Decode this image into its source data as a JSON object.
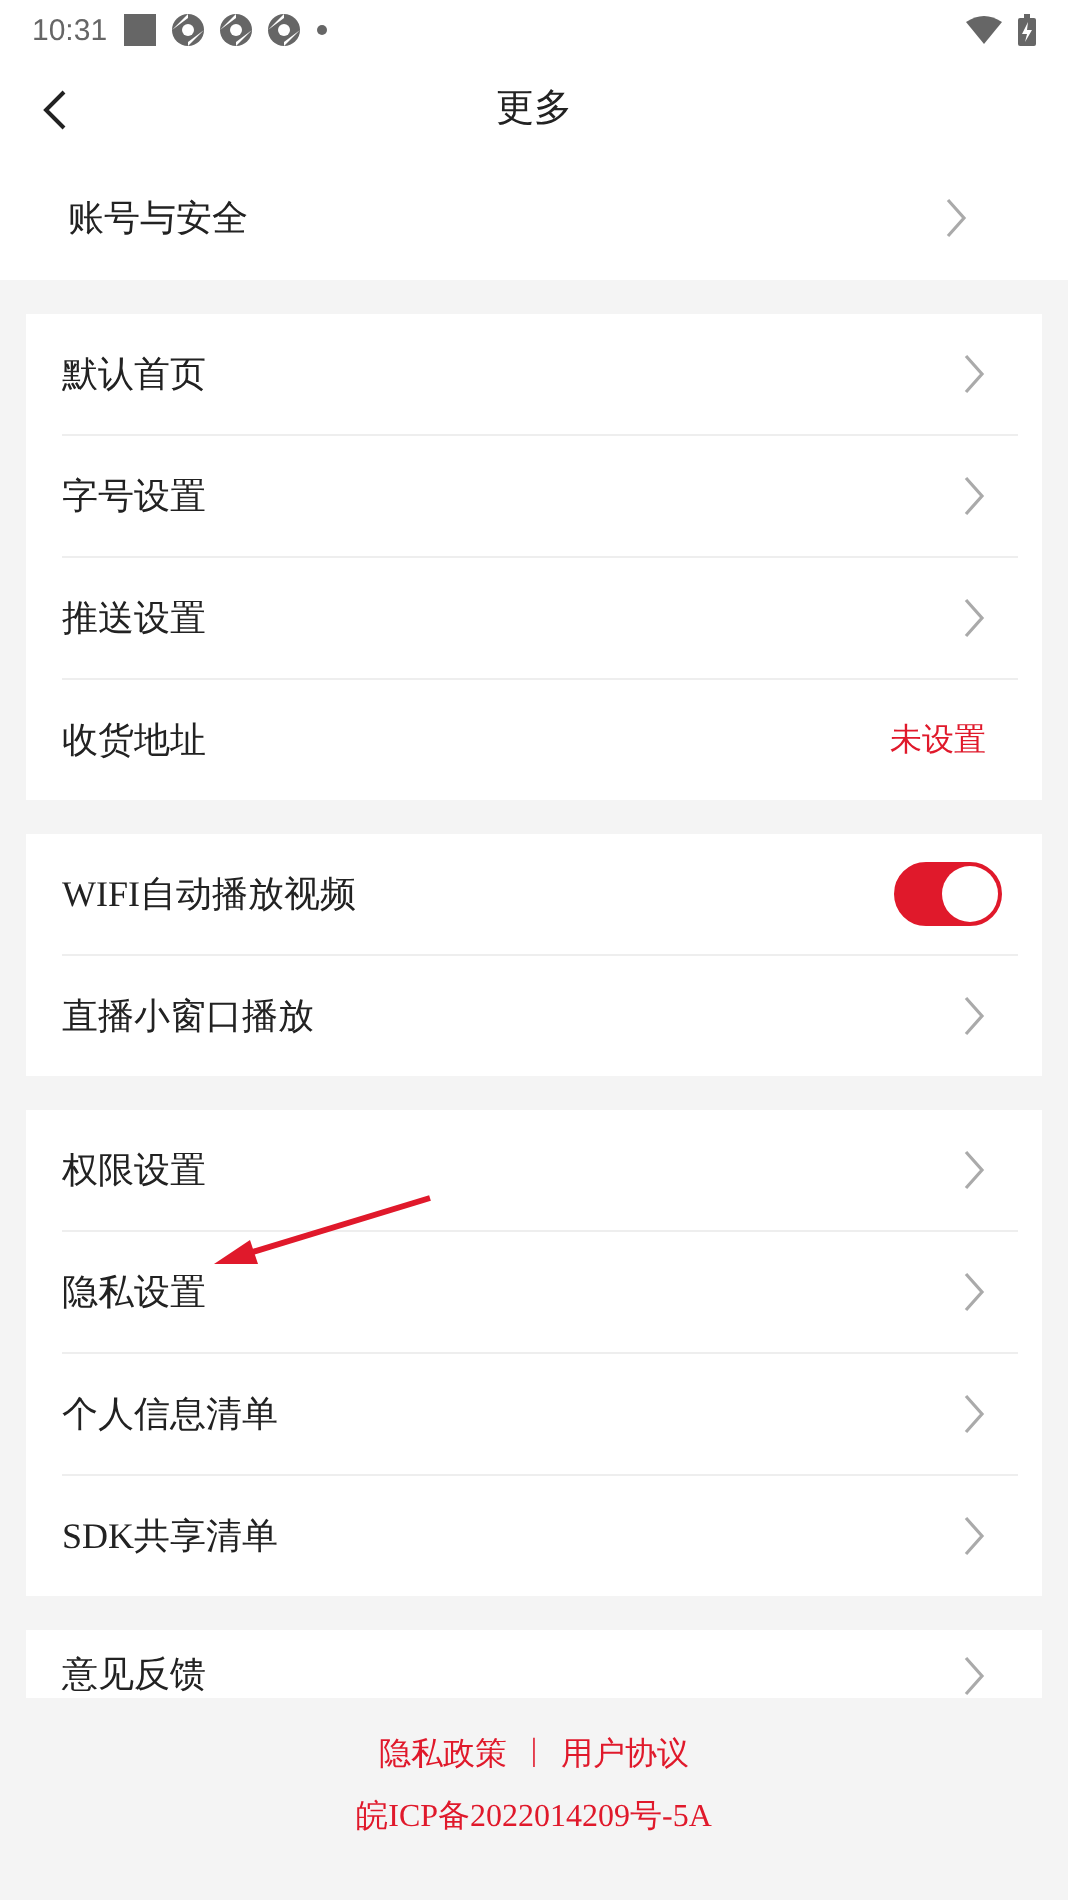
{
  "status_bar": {
    "time": "10:31"
  },
  "header": {
    "title": "更多"
  },
  "account": {
    "label": "账号与安全",
    "kind": "link"
  },
  "groups": [
    {
      "items": [
        {
          "label": "默认首页",
          "kind": "link"
        },
        {
          "label": "字号设置",
          "kind": "link"
        },
        {
          "label": "推送设置",
          "kind": "link"
        },
        {
          "label": "收货地址",
          "kind": "value",
          "value": "未设置"
        }
      ]
    },
    {
      "items": [
        {
          "label": "WIFI自动播放视频",
          "kind": "toggle",
          "on": true
        },
        {
          "label": "直播小窗口播放",
          "kind": "link"
        }
      ]
    },
    {
      "items": [
        {
          "label": "权限设置",
          "kind": "link"
        },
        {
          "label": "隐私设置",
          "kind": "link",
          "annotated": true
        },
        {
          "label": "个人信息清单",
          "kind": "link"
        },
        {
          "label": "SDK共享清单",
          "kind": "link"
        }
      ]
    },
    {
      "items": [
        {
          "label": "意见反馈",
          "kind": "link"
        }
      ]
    }
  ],
  "footer": {
    "links": [
      "隐私政策",
      "用户协议"
    ],
    "separator": "|",
    "icp": "皖ICP备2022014209号-5A"
  }
}
